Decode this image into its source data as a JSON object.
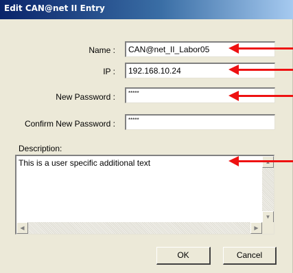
{
  "dialog": {
    "title": "Edit CAN@net II Entry"
  },
  "form": {
    "name_label": "Name :",
    "name_value": "CAN@net_II_Labor05",
    "ip_label": "IP :",
    "ip_value": "192.168.10.24",
    "new_password_label": "New Password :",
    "new_password_value": "*****",
    "confirm_password_label": "Confirm New Password :",
    "confirm_password_value": "*****",
    "description_label": "Description:",
    "description_value": "This is a user specific additional text"
  },
  "buttons": {
    "ok_label": "OK",
    "cancel_label": "Cancel"
  },
  "annotations": {
    "arrow_color": "#ee1111"
  },
  "icons": {
    "scroll_up": "scroll-up-arrow-icon",
    "scroll_down": "scroll-down-arrow-icon",
    "scroll_left": "scroll-left-arrow-icon",
    "scroll_right": "scroll-right-arrow-icon"
  }
}
